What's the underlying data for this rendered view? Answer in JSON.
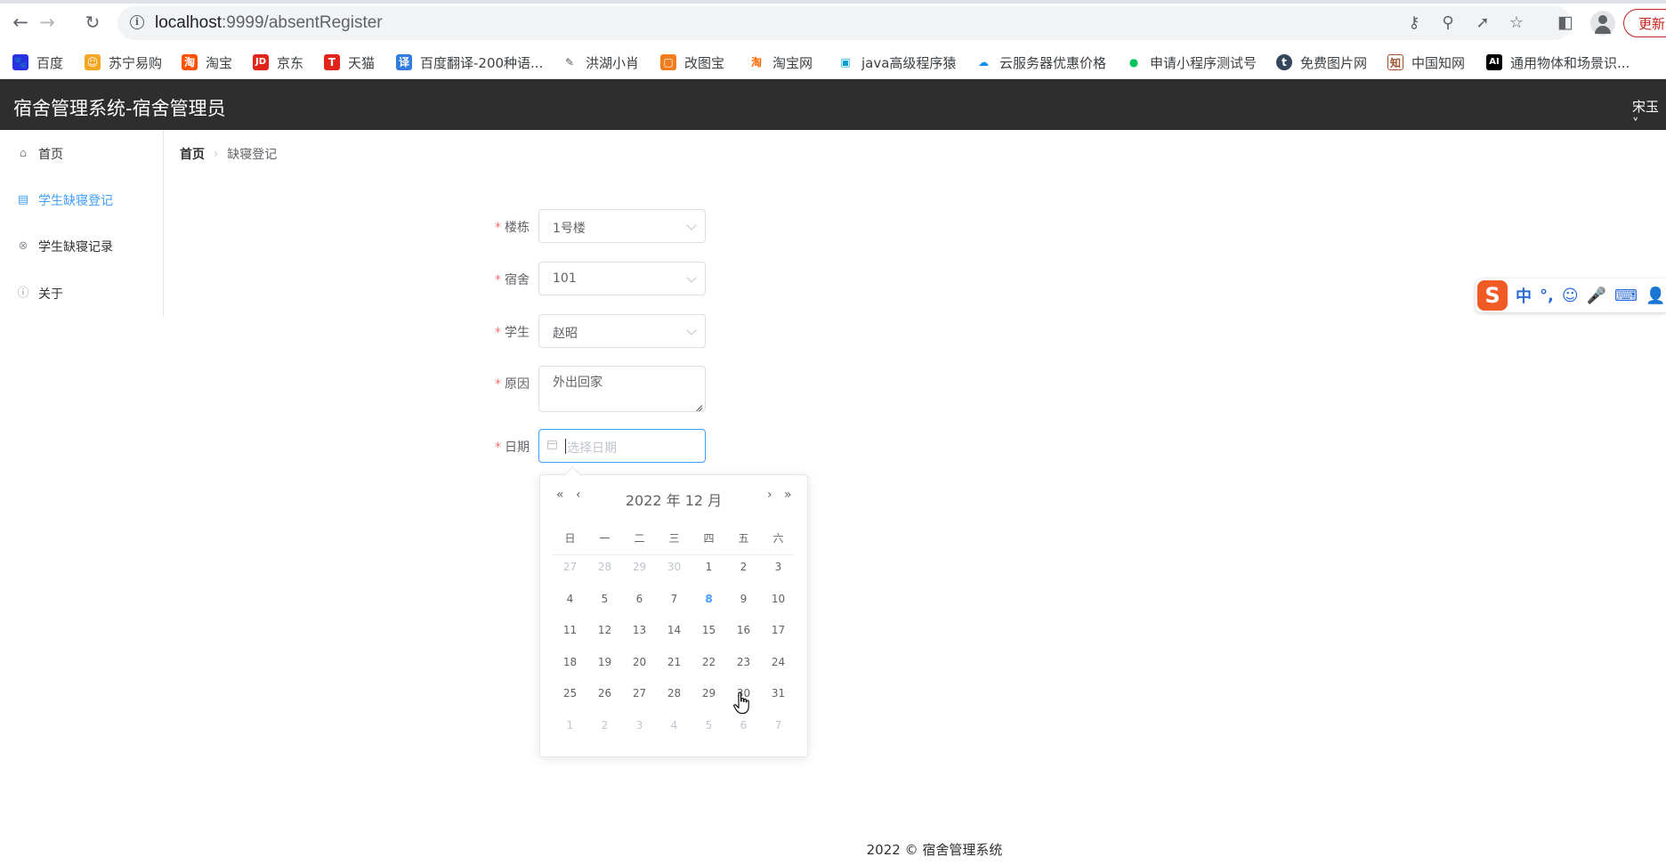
{
  "browser": {
    "url_host": "localhost",
    "url_rest": ":9999/absentRegister",
    "update_label": "更新",
    "bookmarks": [
      {
        "label": "百度",
        "color": "#2932e1",
        "glyph": "🐾"
      },
      {
        "label": "苏宁易购",
        "color": "#f5a623",
        "glyph": "☺"
      },
      {
        "label": "淘宝",
        "color": "#ff5000",
        "glyph": "淘"
      },
      {
        "label": "京东",
        "color": "#e1251b",
        "glyph": "JD"
      },
      {
        "label": "天猫",
        "color": "#e1251b",
        "glyph": "T"
      },
      {
        "label": "百度翻译-200种语...",
        "color": "#2f7de1",
        "glyph": "译"
      },
      {
        "label": "洪湖小肖",
        "color": "#666666",
        "glyph": "✎"
      },
      {
        "label": "改图宝",
        "color": "#f07c1c",
        "glyph": "▢"
      },
      {
        "label": "淘宝网",
        "color": "#ff6a00",
        "glyph": "淘"
      },
      {
        "label": "java高级程序猿",
        "color": "#00a1d6",
        "glyph": "▣"
      },
      {
        "label": "云服务器优惠价格",
        "color": "#0091ea",
        "glyph": "☁"
      },
      {
        "label": "申请小程序测试号",
        "color": "#07c160",
        "glyph": "●"
      },
      {
        "label": "免费图片网",
        "color": "#35465c",
        "glyph": "t"
      },
      {
        "label": "中国知网",
        "color": "#a0522d",
        "glyph": "知"
      },
      {
        "label": "通用物体和场景识...",
        "color": "#000000",
        "glyph": "AI"
      }
    ]
  },
  "app": {
    "title": "宿舍管理系统-宿舍管理员",
    "user": "宋玉 ˅"
  },
  "sidebar": {
    "items": [
      {
        "label": "首页",
        "icon": "home-icon",
        "active": false
      },
      {
        "label": "学生缺寝登记",
        "icon": "clipboard-icon",
        "active": true
      },
      {
        "label": "学生缺寝记录",
        "icon": "circle-close-icon",
        "active": false
      },
      {
        "label": "关于",
        "icon": "info-icon",
        "active": false
      }
    ]
  },
  "breadcrumb": {
    "home": "首页",
    "current": "缺寝登记"
  },
  "form": {
    "building": {
      "label": "楼栋",
      "value": "1号楼"
    },
    "dorm": {
      "label": "宿舍",
      "value": "101"
    },
    "student": {
      "label": "学生",
      "value": "赵昭"
    },
    "reason": {
      "label": "原因",
      "value": "外出回家"
    },
    "date": {
      "label": "日期",
      "placeholder": "选择日期",
      "value": ""
    }
  },
  "datepicker": {
    "title": "2022 年  12 月",
    "weekdays": [
      "日",
      "一",
      "二",
      "三",
      "四",
      "五",
      "六"
    ],
    "today": "8",
    "weeks": [
      [
        {
          "d": "27",
          "o": true
        },
        {
          "d": "28",
          "o": true
        },
        {
          "d": "29",
          "o": true
        },
        {
          "d": "30",
          "o": true
        },
        {
          "d": "1"
        },
        {
          "d": "2"
        },
        {
          "d": "3"
        }
      ],
      [
        {
          "d": "4"
        },
        {
          "d": "5"
        },
        {
          "d": "6"
        },
        {
          "d": "7"
        },
        {
          "d": "8",
          "t": true
        },
        {
          "d": "9"
        },
        {
          "d": "10"
        }
      ],
      [
        {
          "d": "11"
        },
        {
          "d": "12"
        },
        {
          "d": "13"
        },
        {
          "d": "14"
        },
        {
          "d": "15"
        },
        {
          "d": "16"
        },
        {
          "d": "17"
        }
      ],
      [
        {
          "d": "18"
        },
        {
          "d": "19"
        },
        {
          "d": "20"
        },
        {
          "d": "21"
        },
        {
          "d": "22"
        },
        {
          "d": "23"
        },
        {
          "d": "24"
        }
      ],
      [
        {
          "d": "25"
        },
        {
          "d": "26"
        },
        {
          "d": "27"
        },
        {
          "d": "28"
        },
        {
          "d": "29"
        },
        {
          "d": "30"
        },
        {
          "d": "31"
        }
      ],
      [
        {
          "d": "1",
          "o": true
        },
        {
          "d": "2",
          "o": true
        },
        {
          "d": "3",
          "o": true
        },
        {
          "d": "4",
          "o": true
        },
        {
          "d": "5",
          "o": true
        },
        {
          "d": "6",
          "o": true
        },
        {
          "d": "7",
          "o": true
        }
      ]
    ]
  },
  "ime": {
    "logo": "S",
    "items": [
      "中",
      "°,",
      "☺",
      "🎤",
      "⌨",
      "👤"
    ]
  },
  "footer": {
    "text": "2022 © 宿舍管理系统"
  },
  "colors": {
    "accent": "#409eff",
    "header_bg": "#2e2e2e",
    "required": "#f56c6c"
  }
}
